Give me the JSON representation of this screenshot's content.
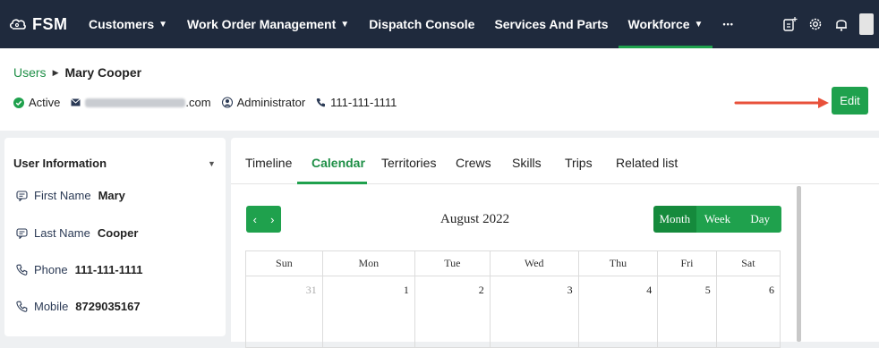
{
  "nav": {
    "brand": "FSM",
    "items": [
      {
        "label": "Customers",
        "caret": true,
        "active": false
      },
      {
        "label": "Work Order Management",
        "caret": true,
        "active": false
      },
      {
        "label": "Dispatch Console",
        "caret": false,
        "active": false
      },
      {
        "label": "Services And Parts",
        "caret": false,
        "active": false
      },
      {
        "label": "Workforce",
        "caret": true,
        "active": true
      }
    ],
    "more": "•••"
  },
  "breadcrumb": {
    "parent": "Users",
    "current": "Mary Cooper"
  },
  "meta": {
    "status": "Active",
    "email_suffix": ".com",
    "role": "Administrator",
    "phone": "111-111-1111"
  },
  "edit_label": "Edit",
  "user_info": {
    "heading": "User Information",
    "rows": [
      {
        "label": "First Name",
        "value": "Mary",
        "icon": "name-card-icon"
      },
      {
        "label": "Last Name",
        "value": "Cooper",
        "icon": "name-card-icon"
      },
      {
        "label": "Phone",
        "value": "111-111-1111",
        "icon": "phone-icon"
      },
      {
        "label": "Mobile",
        "value": "8729035167",
        "icon": "phone-icon"
      }
    ]
  },
  "tabs": [
    "Timeline",
    "Calendar",
    "Territories",
    "Crews",
    "Skills",
    "Trips",
    "Related list"
  ],
  "active_tab": "Calendar",
  "calendar": {
    "title": "August 2022",
    "prev": "‹",
    "next": "›",
    "views": [
      "Month",
      "Week",
      "Day"
    ],
    "active_view": "Month",
    "weekdays": [
      "Sun",
      "Mon",
      "Tue",
      "Wed",
      "Thu",
      "Fri",
      "Sat"
    ],
    "first_week": [
      "31",
      "1",
      "2",
      "3",
      "4",
      "5",
      "6"
    ]
  },
  "colors": {
    "nav_bg": "#1f2a3d",
    "accent": "#1fa14d",
    "arrow": "#e8503a"
  }
}
